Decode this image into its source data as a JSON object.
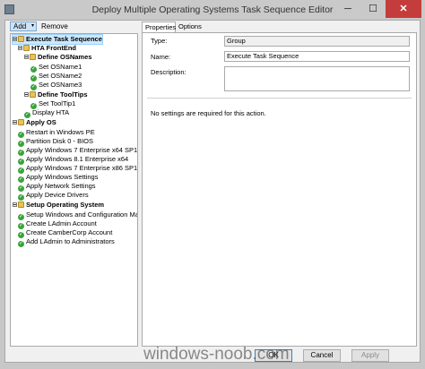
{
  "window": {
    "title": "Deploy Multiple Operating Systems Task Sequence Editor",
    "minimize_glyph": "─",
    "maximize_glyph": "☐",
    "close_glyph": "✕"
  },
  "toolbar": {
    "add_label": "Add",
    "add_arrow": "▾",
    "remove_label": "Remove"
  },
  "tree": [
    {
      "label": "Execute Task Sequence",
      "icon": "folder-icon",
      "bold": true,
      "expander": true,
      "selected": true
    },
    {
      "label": "HTA FrontEnd",
      "icon": "folder-icon",
      "bold": true,
      "expander": true
    },
    {
      "label": "Define OSNames",
      "icon": "folder-icon",
      "bold": true,
      "expander": true
    },
    {
      "label": "Set OSName1",
      "icon": "check-icon"
    },
    {
      "label": "Set OSName2",
      "icon": "check-icon"
    },
    {
      "label": "Set OSName3",
      "icon": "check-icon"
    },
    {
      "label": "Define ToolTips",
      "icon": "folder-icon",
      "bold": true,
      "expander": true
    },
    {
      "label": "Set ToolTip1",
      "icon": "check-icon"
    },
    {
      "label": "Display HTA",
      "icon": "check-icon"
    },
    {
      "label": "Apply OS",
      "icon": "folder-icon",
      "bold": true,
      "expander": true
    },
    {
      "label": "Restart in Windows PE",
      "icon": "check-icon"
    },
    {
      "label": "Partition Disk 0 - BIOS",
      "icon": "check-icon"
    },
    {
      "label": "Apply Windows 7 Enterprise x64 SP1",
      "icon": "check-icon"
    },
    {
      "label": "Apply Windows 8.1 Enterprise x64",
      "icon": "check-icon"
    },
    {
      "label": "Apply Windows 7 Enterprise x86 SP1",
      "icon": "check-icon"
    },
    {
      "label": "Apply Windows Settings",
      "icon": "check-icon"
    },
    {
      "label": "Apply Network Settings",
      "icon": "check-icon"
    },
    {
      "label": "Apply Device Drivers",
      "icon": "check-icon"
    },
    {
      "label": "Setup Operating System",
      "icon": "folder-icon",
      "bold": true,
      "expander": true
    },
    {
      "label": "Setup Windows and Configuration Ma",
      "icon": "check-icon"
    },
    {
      "label": "Create LAdmin Account",
      "icon": "check-icon"
    },
    {
      "label": "Create CamberCorp Account",
      "icon": "check-icon"
    },
    {
      "label": "Add LAdmin to Administrators",
      "icon": "check-icon"
    }
  ],
  "tabs": {
    "properties": "Properties",
    "options": "Options"
  },
  "properties": {
    "type_label": "Type:",
    "type_value": "Group",
    "name_label": "Name:",
    "name_value": "Execute Task Sequence",
    "description_label": "Description:",
    "description_value": "",
    "note": "No settings are required  for this action."
  },
  "buttons": {
    "ok": "OK",
    "cancel": "Cancel",
    "apply": "Apply"
  },
  "watermark": "windows-noob.com",
  "colors": {
    "close": "#c43c3c",
    "selection": "#cce8ff",
    "check": "#3aa33a",
    "folder": "#e8c35a"
  }
}
